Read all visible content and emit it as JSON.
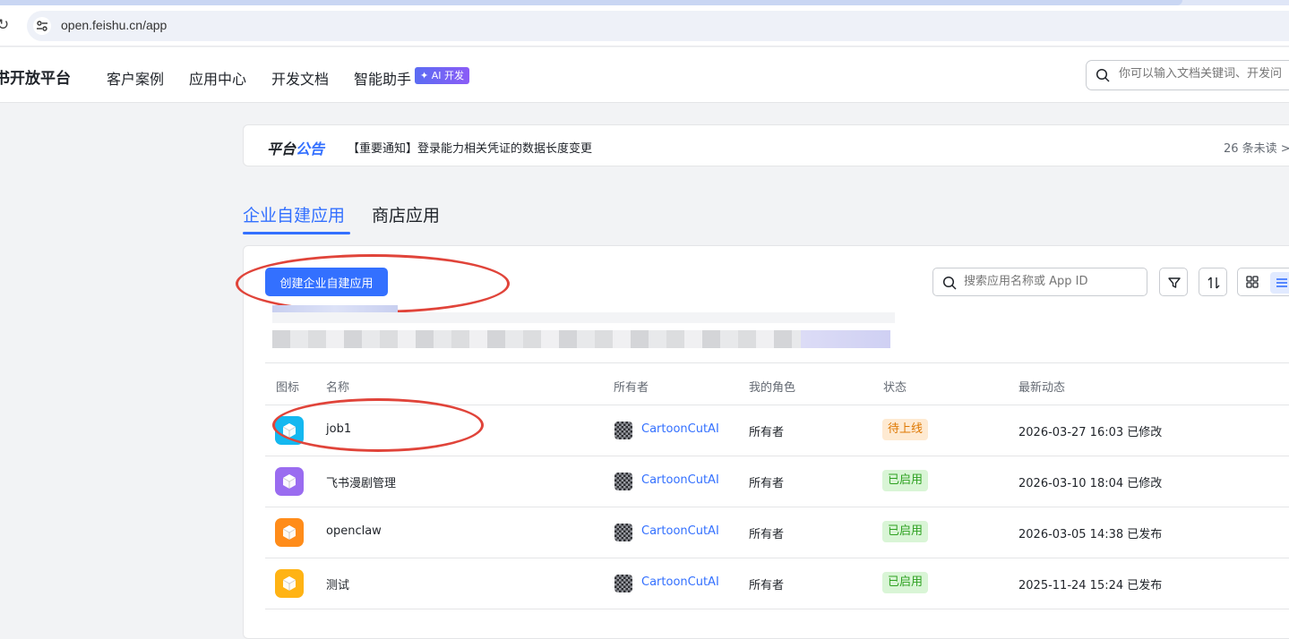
{
  "browser": {
    "url": "open.feishu.cn/app",
    "reload_icon": "reload-icon",
    "site_settings_icon": "tune-icon"
  },
  "header": {
    "brand": "书开放平台",
    "nav": [
      "客户案例",
      "应用中心",
      "开发文档",
      "智能助手"
    ],
    "ai_badge": "✦ AI 开发",
    "search_placeholder": "你可以输入文档关键词、开发问"
  },
  "announcement": {
    "title_part1": "平台",
    "title_part2": "公告",
    "text": "【重要通知】登录能力相关凭证的数据长度变更",
    "unread": "26 条未读 >"
  },
  "tabs": [
    {
      "label": "企业自建应用",
      "active": true
    },
    {
      "label": "商店应用",
      "active": false
    }
  ],
  "toolbar": {
    "create_label": "创建企业自建应用",
    "search_placeholder": "搜索应用名称或 App ID",
    "filter_icon": "filter-icon",
    "sort_icon": "sort-icon",
    "grid_view_icon": "grid-view-icon",
    "list_view_icon": "list-view-icon"
  },
  "table": {
    "columns": [
      "图标",
      "名称",
      "所有者",
      "我的角色",
      "状态",
      "最新动态"
    ],
    "rows": [
      {
        "name": "job1",
        "owner": "CartoonCutAI",
        "role": "所有者",
        "status": "待上线",
        "status_kind": "pending",
        "activity": "2026-03-27 16:03 已修改",
        "icon_color": "#14b8f0"
      },
      {
        "name": "飞书漫剧管理",
        "owner": "CartoonCutAI",
        "role": "所有者",
        "status": "已启用",
        "status_kind": "enabled",
        "activity": "2026-03-10 18:04 已修改",
        "icon_color": "#9a6cf0"
      },
      {
        "name": "openclaw",
        "owner": "CartoonCutAI",
        "role": "所有者",
        "status": "已启用",
        "status_kind": "enabled",
        "activity": "2026-03-05 14:38 已发布",
        "icon_color": "#ff8c1a"
      },
      {
        "name": "测试",
        "owner": "CartoonCutAI",
        "role": "所有者",
        "status": "已启用",
        "status_kind": "enabled",
        "activity": "2025-11-24 15:24 已发布",
        "icon_color": "#ffb314"
      }
    ]
  },
  "colors": {
    "accent": "#3370ff",
    "annotation": "#e0443a"
  }
}
